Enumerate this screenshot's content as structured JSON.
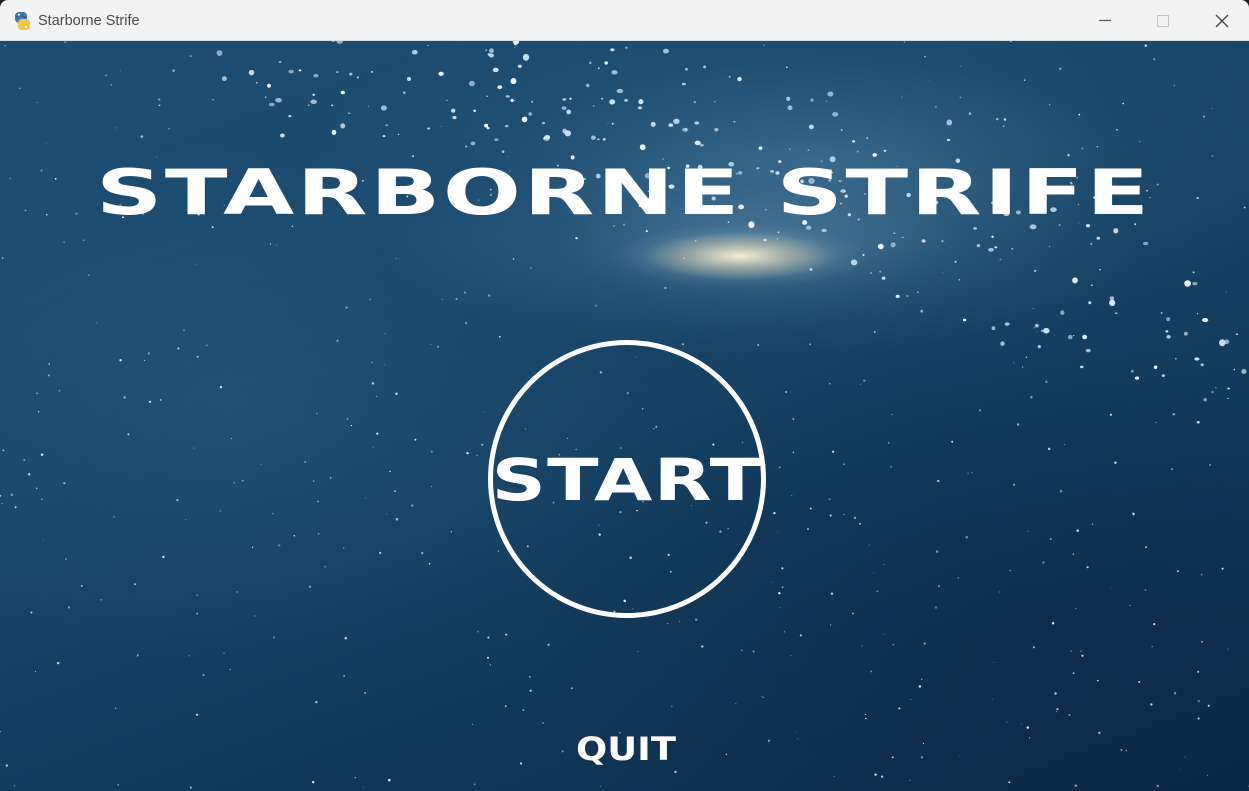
{
  "window": {
    "title": "Starborne Strife",
    "icons": {
      "app": "python-snake-icon",
      "minimize": "minimize-icon",
      "maximize": "maximize-icon",
      "close": "close-icon"
    }
  },
  "menu": {
    "title": "STARBORNE STRIFE",
    "start_label": "START",
    "quit_label": "QUIT"
  },
  "colors": {
    "titlebar": "#f3f3f3",
    "text": "#ffffff",
    "space_dark": "#0c2945",
    "space_mid": "#1b4a6e",
    "galaxy_core": "#fff6d6"
  }
}
